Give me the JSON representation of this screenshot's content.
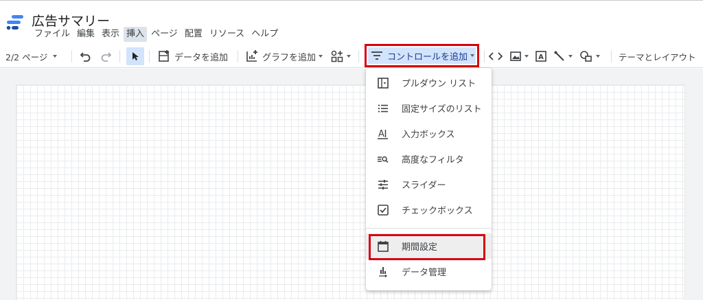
{
  "app": {
    "title": "広告サマリー",
    "menu": [
      "ファイル",
      "編集",
      "表示",
      "挿入",
      "ページ",
      "配置",
      "リソース",
      "ヘルプ"
    ],
    "active_menu": "挿入"
  },
  "toolbar": {
    "page_indicator": "2/2 ページ",
    "add_data": "データを追加",
    "add_chart": "グラフを追加",
    "add_control": "コントロールを追加",
    "theme_layout": "テーマとレイアウト"
  },
  "dropdown": {
    "items": [
      {
        "label": "プルダウン リスト",
        "icon": "dropdown-list-icon"
      },
      {
        "label": "固定サイズのリスト",
        "icon": "list-icon"
      },
      {
        "label": "入力ボックス",
        "icon": "input-box-icon"
      },
      {
        "label": "高度なフィルタ",
        "icon": "advanced-filter-icon"
      },
      {
        "label": "スライダー",
        "icon": "slider-icon"
      },
      {
        "label": "チェックボックス",
        "icon": "checkbox-icon"
      },
      {
        "label": "期間設定",
        "icon": "calendar-icon"
      },
      {
        "label": "データ管理",
        "icon": "data-control-icon"
      }
    ]
  },
  "colors": {
    "highlight_border": "#d7000f",
    "selected_bg": "#d2e3fc",
    "logo_blue": "#4285f4",
    "logo_dark": "#1a4f9c"
  }
}
